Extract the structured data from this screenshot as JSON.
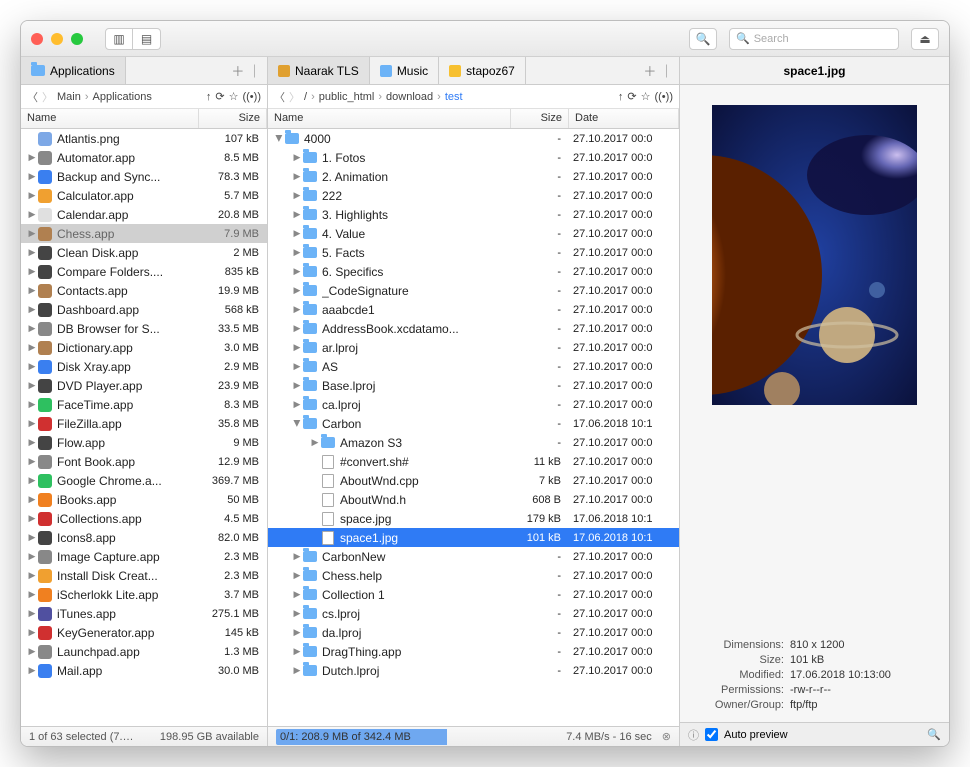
{
  "toolbar": {
    "search_placeholder": "Search"
  },
  "left": {
    "tab": "Applications",
    "breadcrumb": [
      "Main",
      "Applications"
    ],
    "cols": {
      "name": "Name",
      "size": "Size"
    },
    "items": [
      {
        "name": "Atlantis.png",
        "size": "107 kB",
        "ic": "png",
        "arrow": "",
        "c": "#7da8e6"
      },
      {
        "name": "Automator.app",
        "size": "8.5 MB",
        "ic": "app",
        "arrow": "▶",
        "c": "#888"
      },
      {
        "name": "Backup and Sync...",
        "size": "78.3 MB",
        "ic": "app",
        "arrow": "▶",
        "c": "#3a7ff0"
      },
      {
        "name": "Calculator.app",
        "size": "5.7 MB",
        "ic": "app",
        "arrow": "▶",
        "c": "#f0a030"
      },
      {
        "name": "Calendar.app",
        "size": "20.8 MB",
        "ic": "app",
        "arrow": "▶",
        "c": "#e0e0e0"
      },
      {
        "name": "Chess.app",
        "size": "7.9 MB",
        "ic": "app",
        "arrow": "▶",
        "sel": "gray",
        "c": "#b08050"
      },
      {
        "name": "Clean Disk.app",
        "size": "2 MB",
        "ic": "app",
        "arrow": "▶",
        "c": "#444"
      },
      {
        "name": "Compare Folders....",
        "size": "835 kB",
        "ic": "app",
        "arrow": "▶",
        "c": "#444"
      },
      {
        "name": "Contacts.app",
        "size": "19.9 MB",
        "ic": "app",
        "arrow": "▶",
        "c": "#b08050"
      },
      {
        "name": "Dashboard.app",
        "size": "568 kB",
        "ic": "app",
        "arrow": "▶",
        "c": "#444"
      },
      {
        "name": "DB Browser for S...",
        "size": "33.5 MB",
        "ic": "app",
        "arrow": "▶",
        "c": "#888"
      },
      {
        "name": "Dictionary.app",
        "size": "3.0 MB",
        "ic": "app",
        "arrow": "▶",
        "c": "#b08050"
      },
      {
        "name": "Disk Xray.app",
        "size": "2.9 MB",
        "ic": "app",
        "arrow": "▶",
        "c": "#3a7ff0"
      },
      {
        "name": "DVD Player.app",
        "size": "23.9 MB",
        "ic": "app",
        "arrow": "▶",
        "c": "#444"
      },
      {
        "name": "FaceTime.app",
        "size": "8.3 MB",
        "ic": "app",
        "arrow": "▶",
        "c": "#2ec060"
      },
      {
        "name": "FileZilla.app",
        "size": "35.8 MB",
        "ic": "app",
        "arrow": "▶",
        "c": "#d03030"
      },
      {
        "name": "Flow.app",
        "size": "9 MB",
        "ic": "app",
        "arrow": "▶",
        "c": "#444"
      },
      {
        "name": "Font Book.app",
        "size": "12.9 MB",
        "ic": "app",
        "arrow": "▶",
        "c": "#888"
      },
      {
        "name": "Google Chrome.a...",
        "size": "369.7 MB",
        "ic": "app",
        "arrow": "▶",
        "c": "#2ec060"
      },
      {
        "name": "iBooks.app",
        "size": "50 MB",
        "ic": "app",
        "arrow": "▶",
        "c": "#f08020"
      },
      {
        "name": "iCollections.app",
        "size": "4.5 MB",
        "ic": "app",
        "arrow": "▶",
        "c": "#d03030"
      },
      {
        "name": "Icons8.app",
        "size": "82.0 MB",
        "ic": "app",
        "arrow": "▶",
        "c": "#444"
      },
      {
        "name": "Image Capture.app",
        "size": "2.3 MB",
        "ic": "app",
        "arrow": "▶",
        "c": "#888"
      },
      {
        "name": "Install Disk Creat...",
        "size": "2.3 MB",
        "ic": "app",
        "arrow": "▶",
        "c": "#f0a030"
      },
      {
        "name": "iScherlokk Lite.app",
        "size": "3.7 MB",
        "ic": "app",
        "arrow": "▶",
        "c": "#f08020"
      },
      {
        "name": "iTunes.app",
        "size": "275.1 MB",
        "ic": "app",
        "arrow": "▶",
        "c": "#5050a0"
      },
      {
        "name": "KeyGenerator.app",
        "size": "145 kB",
        "ic": "app",
        "arrow": "▶",
        "c": "#d03030"
      },
      {
        "name": "Launchpad.app",
        "size": "1.3 MB",
        "ic": "app",
        "arrow": "▶",
        "c": "#888"
      },
      {
        "name": "Mail.app",
        "size": "30.0 MB",
        "ic": "app",
        "arrow": "▶",
        "c": "#3a7ff0"
      }
    ],
    "status1": "1 of 63 selected (7.…",
    "status2": "198.95 GB available"
  },
  "mid": {
    "tabs": [
      {
        "label": "Naarak TLS",
        "active": true,
        "ic": "#e0a030"
      },
      {
        "label": "Music",
        "ic": "#6cb3f7"
      },
      {
        "label": "stapoz67",
        "ic": "#f7c030"
      }
    ],
    "breadcrumb": [
      "/",
      "public_html",
      "download",
      "test"
    ],
    "cols": {
      "name": "Name",
      "size": "Size",
      "date": "Date"
    },
    "items": [
      {
        "indent": 0,
        "name": "4000",
        "size": "-",
        "date": "27.10.2017 00:0",
        "ic": "folder",
        "arrow": "down"
      },
      {
        "indent": 1,
        "name": "1. Fotos",
        "size": "-",
        "date": "27.10.2017 00:0",
        "ic": "folder",
        "arrow": "▶"
      },
      {
        "indent": 1,
        "name": "2. Animation",
        "size": "-",
        "date": "27.10.2017 00:0",
        "ic": "folder",
        "arrow": "▶"
      },
      {
        "indent": 1,
        "name": "222",
        "size": "-",
        "date": "27.10.2017 00:0",
        "ic": "folder",
        "arrow": "▶"
      },
      {
        "indent": 1,
        "name": "3. Highlights",
        "size": "-",
        "date": "27.10.2017 00:0",
        "ic": "folder",
        "arrow": "▶"
      },
      {
        "indent": 1,
        "name": "4. Value",
        "size": "-",
        "date": "27.10.2017 00:0",
        "ic": "folder",
        "arrow": "▶"
      },
      {
        "indent": 1,
        "name": "5. Facts",
        "size": "-",
        "date": "27.10.2017 00:0",
        "ic": "folder",
        "arrow": "▶"
      },
      {
        "indent": 1,
        "name": "6. Specifics",
        "size": "-",
        "date": "27.10.2017 00:0",
        "ic": "folder",
        "arrow": "▶"
      },
      {
        "indent": 1,
        "name": "_CodeSignature",
        "size": "-",
        "date": "27.10.2017 00:0",
        "ic": "folder",
        "arrow": "▶"
      },
      {
        "indent": 1,
        "name": "aaabcde1",
        "size": "-",
        "date": "27.10.2017 00:0",
        "ic": "folder",
        "arrow": "▶"
      },
      {
        "indent": 1,
        "name": "AddressBook.xcdatamo...",
        "size": "-",
        "date": "27.10.2017 00:0",
        "ic": "folder",
        "arrow": "▶"
      },
      {
        "indent": 1,
        "name": "ar.lproj",
        "size": "-",
        "date": "27.10.2017 00:0",
        "ic": "folder",
        "arrow": "▶"
      },
      {
        "indent": 1,
        "name": "AS",
        "size": "-",
        "date": "27.10.2017 00:0",
        "ic": "folder",
        "arrow": "▶"
      },
      {
        "indent": 1,
        "name": "Base.lproj",
        "size": "-",
        "date": "27.10.2017 00:0",
        "ic": "folder",
        "arrow": "▶"
      },
      {
        "indent": 1,
        "name": "ca.lproj",
        "size": "-",
        "date": "27.10.2017 00:0",
        "ic": "folder",
        "arrow": "▶"
      },
      {
        "indent": 1,
        "name": "Carbon",
        "size": "-",
        "date": "17.06.2018 10:1",
        "ic": "folder",
        "arrow": "down"
      },
      {
        "indent": 2,
        "name": "Amazon S3",
        "size": "-",
        "date": "27.10.2017 00:0",
        "ic": "folder",
        "arrow": "▶"
      },
      {
        "indent": 2,
        "name": "#convert.sh#",
        "size": "11 kB",
        "date": "27.10.2017 00:0",
        "ic": "file",
        "arrow": ""
      },
      {
        "indent": 2,
        "name": "AboutWnd.cpp",
        "size": "7 kB",
        "date": "27.10.2017 00:0",
        "ic": "file",
        "arrow": ""
      },
      {
        "indent": 2,
        "name": "AboutWnd.h",
        "size": "608 B",
        "date": "27.10.2017 00:0",
        "ic": "file",
        "arrow": "",
        "c": "#d03030"
      },
      {
        "indent": 2,
        "name": "space.jpg",
        "size": "179 kB",
        "date": "17.06.2018 10:1",
        "ic": "file",
        "arrow": ""
      },
      {
        "indent": 2,
        "name": "space1.jpg",
        "size": "101 kB",
        "date": "17.06.2018 10:1",
        "ic": "file",
        "arrow": "",
        "sel": "blue"
      },
      {
        "indent": 1,
        "name": "CarbonNew",
        "size": "-",
        "date": "27.10.2017 00:0",
        "ic": "folder",
        "arrow": "▶"
      },
      {
        "indent": 1,
        "name": "Chess.help",
        "size": "-",
        "date": "27.10.2017 00:0",
        "ic": "folder",
        "arrow": "▶"
      },
      {
        "indent": 1,
        "name": "Collection 1",
        "size": "-",
        "date": "27.10.2017 00:0",
        "ic": "folder",
        "arrow": "▶"
      },
      {
        "indent": 1,
        "name": "cs.lproj",
        "size": "-",
        "date": "27.10.2017 00:0",
        "ic": "folder",
        "arrow": "▶"
      },
      {
        "indent": 1,
        "name": "da.lproj",
        "size": "-",
        "date": "27.10.2017 00:0",
        "ic": "folder",
        "arrow": "▶"
      },
      {
        "indent": 1,
        "name": "DragThing.app",
        "size": "-",
        "date": "27.10.2017 00:0",
        "ic": "folder",
        "arrow": "▶"
      },
      {
        "indent": 1,
        "name": "Dutch.lproj",
        "size": "-",
        "date": "27.10.2017 00:0",
        "ic": "folder",
        "arrow": "▶"
      }
    ],
    "status1": "0/1: 208.9 MB of 342.4 MB",
    "status2": "7.4 MB/s - 16 sec"
  },
  "right": {
    "title": "space1.jpg",
    "meta": {
      "dimensions_lbl": "Dimensions:",
      "dimensions": "810 x 1200",
      "size_lbl": "Size:",
      "size": "101 kB",
      "modified_lbl": "Modified:",
      "modified": "17.06.2018 10:13:00",
      "permissions_lbl": "Permissions:",
      "permissions": "-rw-r--r--",
      "owner_lbl": "Owner/Group:",
      "owner": "ftp/ftp"
    },
    "auto_preview": "Auto preview"
  }
}
